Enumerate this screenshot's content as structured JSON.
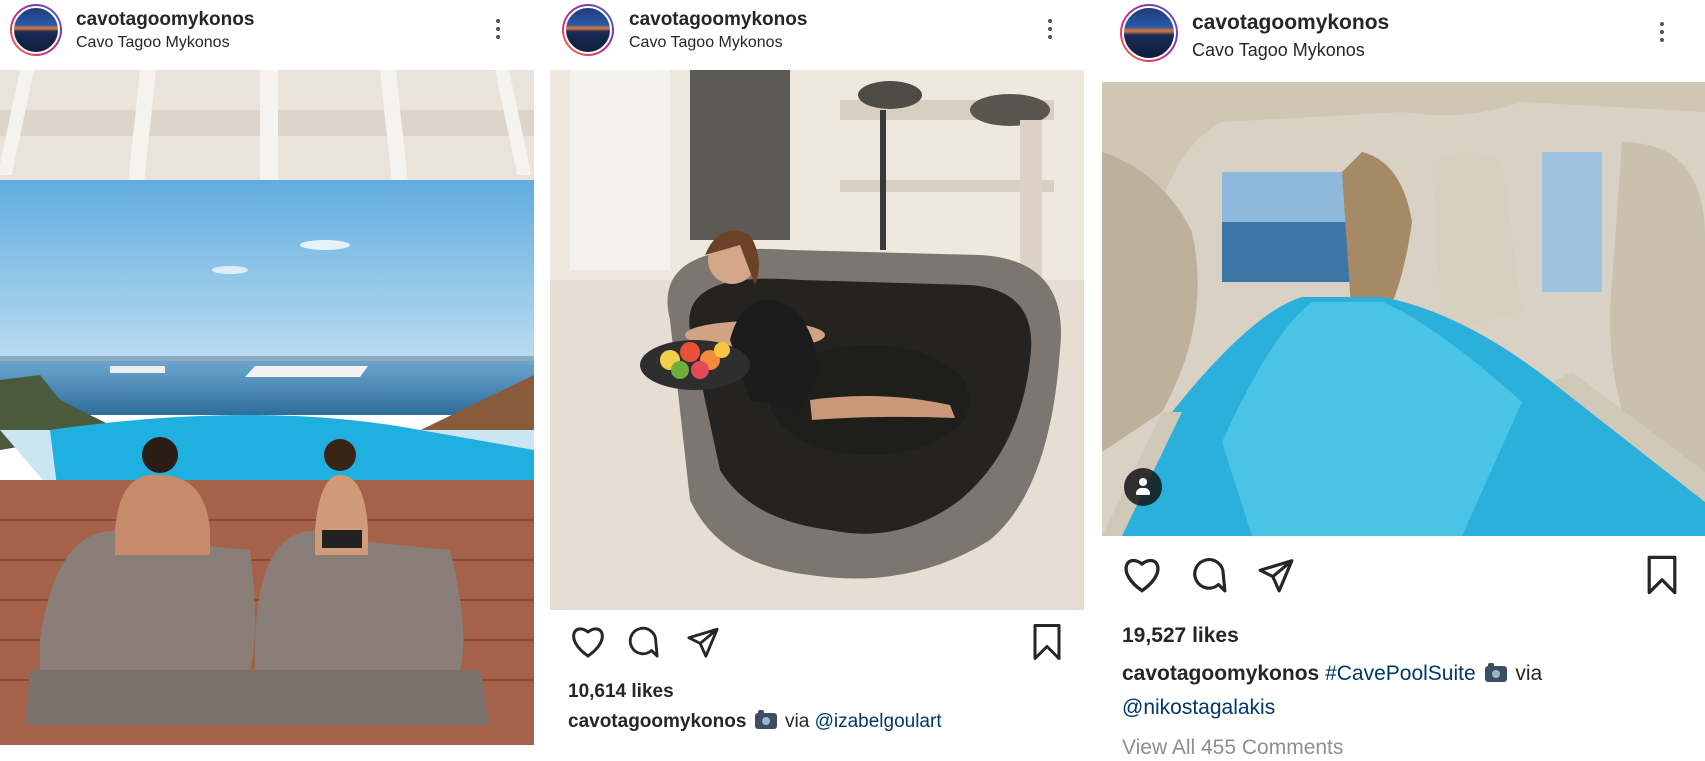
{
  "posts": [
    {
      "username": "cavotagoomykonos",
      "location": "Cavo Tagoo Mykonos",
      "photo_icon": "photo-poolside-couple"
    },
    {
      "username": "cavotagoomykonos",
      "location": "Cavo Tagoo Mykonos",
      "photo_icon": "photo-stone-bathtub",
      "likes": "10,614 likes",
      "caption_user": "cavotagoomykonos",
      "caption_text": "via",
      "caption_mention": "@izabelgoulart"
    },
    {
      "username": "cavotagoomykonos",
      "location": "Cavo Tagoo Mykonos",
      "photo_icon": "photo-cave-pool",
      "likes": "19,527 likes",
      "caption_user": "cavotagoomykonos",
      "caption_hashtag": "#CavePoolSuite",
      "caption_text": "via",
      "caption_mention": "@nikostagalakis",
      "comments": "View All 455 Comments"
    }
  ],
  "icons": [
    "more-options-icon",
    "heart-icon",
    "comment-icon",
    "share-icon",
    "bookmark-icon",
    "user-tag-icon",
    "camera-emoji-icon"
  ],
  "colors": {
    "text": "#262626",
    "link": "#00376b",
    "muted": "#8e8e8e"
  }
}
